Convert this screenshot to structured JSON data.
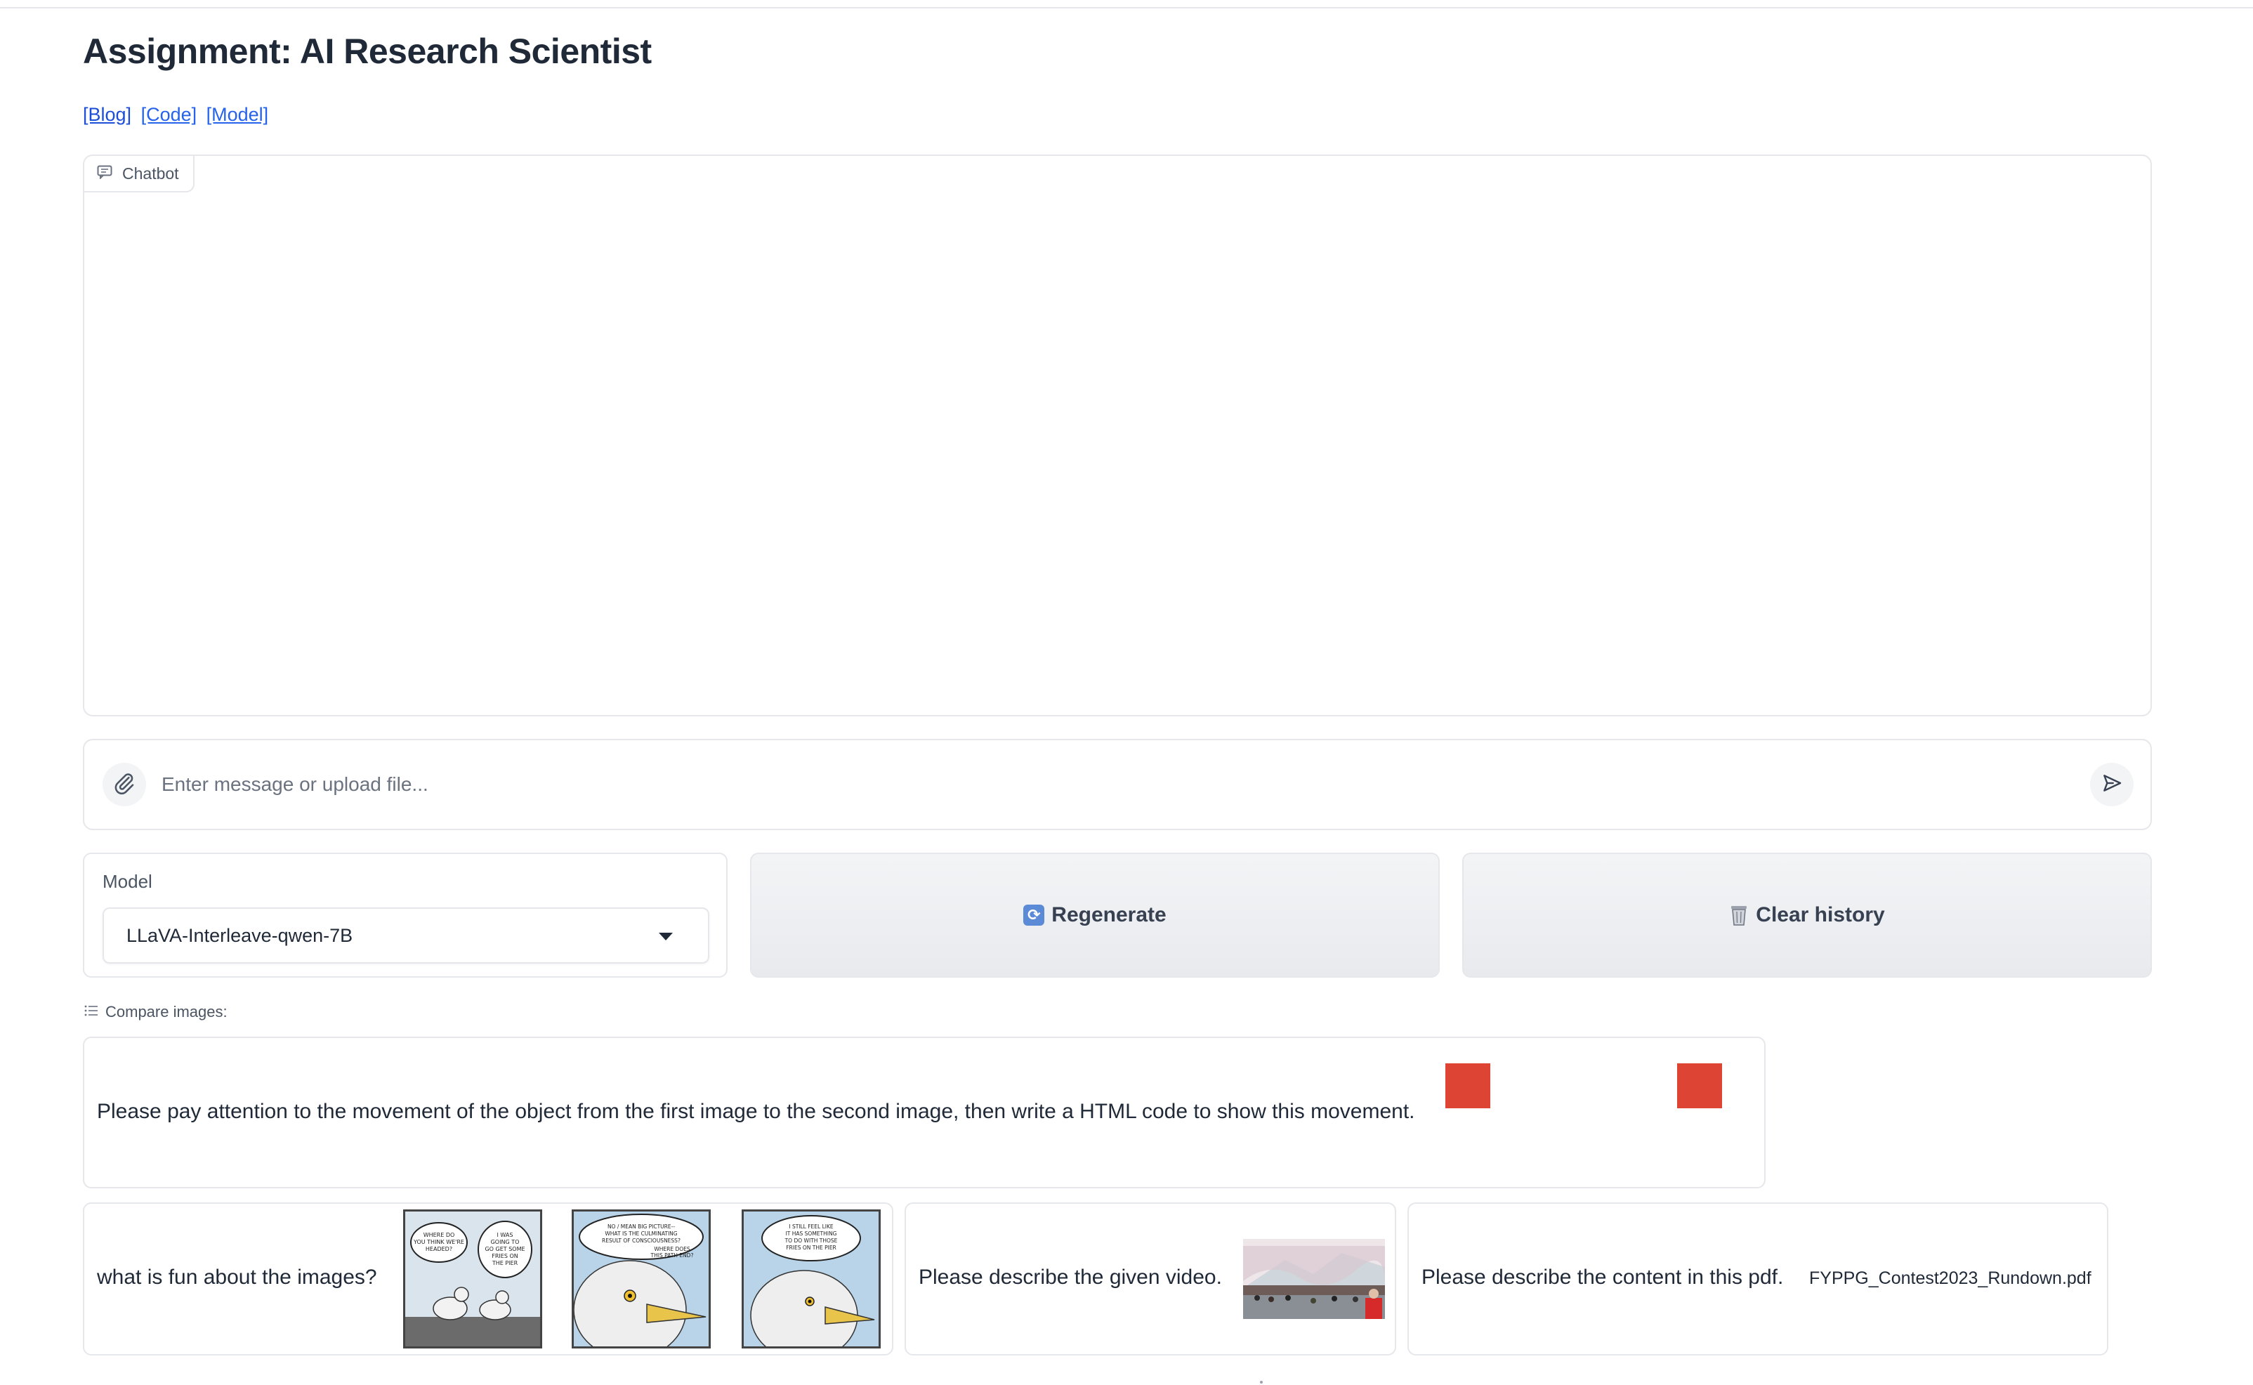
{
  "page": {
    "title": "Assignment: AI Research Scientist"
  },
  "links": [
    {
      "label": "[Blog]"
    },
    {
      "label": "[Code]"
    },
    {
      "label": "[Model]"
    }
  ],
  "chatbot": {
    "label": "Chatbot",
    "icon": "chat-icon"
  },
  "input": {
    "placeholder": "Enter message or upload file...",
    "value": ""
  },
  "model": {
    "label": "Model",
    "selected": "LLaVA-Interleave-qwen-7B"
  },
  "buttons": {
    "regenerate": "Regenerate",
    "clear_history": "Clear history"
  },
  "examples": {
    "label": "Compare images:",
    "items": [
      {
        "text": "Please pay attention to the movement of the object from the first image to the second image, then write a HTML code to show this movement."
      },
      {
        "text": "what is fun about the images?",
        "comic": [
          "WHERE DO YOU THINK WE'RE HEADED?",
          "I WAS GOING TO GO GET SOME FRIES ON THE PIER",
          "NO / MEAN BIG PICTURE-- WHAT IS THE CULMINATING RESULT OF CONSCIOUSNESS? WHERE DOES THIS PATH END?",
          "I STILL FEEL LIKE IT HAS SOMETHING TO DO WITH THOSE FRIES ON THE PIER"
        ]
      },
      {
        "text": "Please describe the given video."
      },
      {
        "text": "Please describe the content in this pdf.",
        "file": "FYPPG_Contest2023_Rundown.pdf"
      }
    ]
  },
  "colors": {
    "accent_red": "#dd4433",
    "link": "#2563eb"
  }
}
